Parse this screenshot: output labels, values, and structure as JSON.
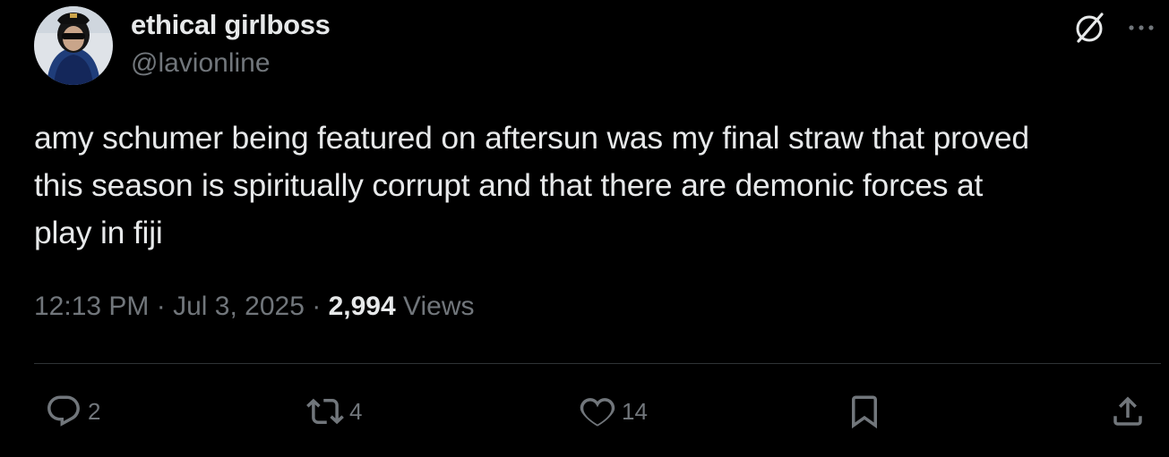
{
  "author": {
    "display_name": "ethical girlboss",
    "handle": "@lavionline",
    "avatar_icon": "avatar-photo"
  },
  "header_icons": {
    "grok": "grok-icon",
    "more": "more-icon"
  },
  "tweet": {
    "lines": [
      "amy schumer being featured on aftersun was my final straw that proved",
      "this season is spiritually corrupt and that there are demonic forces at",
      "play in fiji"
    ]
  },
  "meta": {
    "time": "12:13 PM",
    "separator": "·",
    "date": "Jul 3, 2025",
    "views_count": "2,994",
    "views_label": "Views"
  },
  "actions": {
    "replies": "2",
    "reposts": "4",
    "likes": "14"
  },
  "colors": {
    "background": "#000000",
    "primary_text": "#e7e9ea",
    "secondary_text": "#71767b",
    "divider": "#2f3336"
  }
}
